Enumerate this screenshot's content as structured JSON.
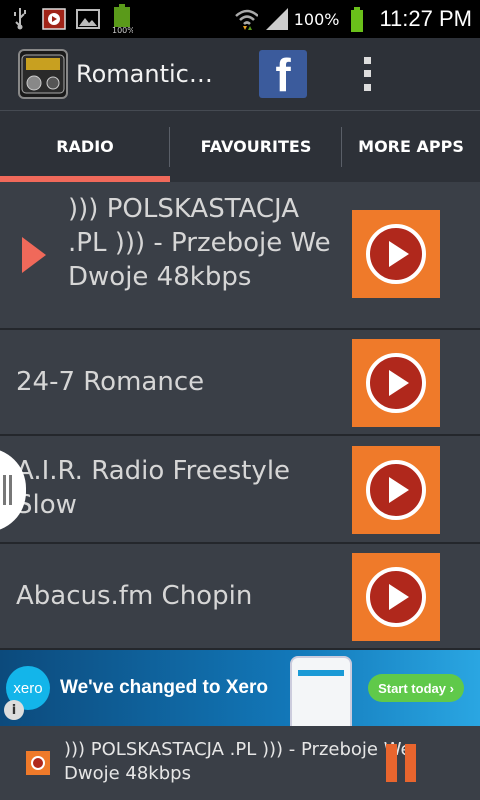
{
  "status_bar": {
    "battery_percent": "100%",
    "time": "11:27 PM",
    "icons": [
      "usb-icon",
      "media-play-icon",
      "image-icon",
      "battery-icon",
      "wifi-icon",
      "signal-icon",
      "battery-full-icon"
    ]
  },
  "action_bar": {
    "app_title": "Romantic…",
    "facebook_letter": "f"
  },
  "tabs": [
    {
      "label": "RADIO",
      "selected": true
    },
    {
      "label": "FAVOURITES",
      "selected": false
    },
    {
      "label": "MORE APPS",
      "selected": false
    }
  ],
  "stations": [
    {
      "name": "))) POLSKASTACJA .PL ))) - Przeboje We Dwoje  48kbps",
      "now_playing": true
    },
    {
      "name": "24-7 Romance",
      "now_playing": false
    },
    {
      "name": "A.I.R. Radio Freestyle Slow",
      "now_playing": false
    },
    {
      "name": "Abacus.fm Chopin",
      "now_playing": false
    }
  ],
  "ad": {
    "logo_text": "xero",
    "headline": "We've changed to Xero",
    "cta": "Start today ›",
    "info": "i"
  },
  "player": {
    "now_playing_text": "))) POLSKASTACJA .PL ))) - Przeboje We Dwoje  48kbps"
  },
  "colors": {
    "accent": "#f0695a",
    "play_button": "#ef7a2a",
    "background": "#3a3f47",
    "bar": "#2d3138"
  }
}
